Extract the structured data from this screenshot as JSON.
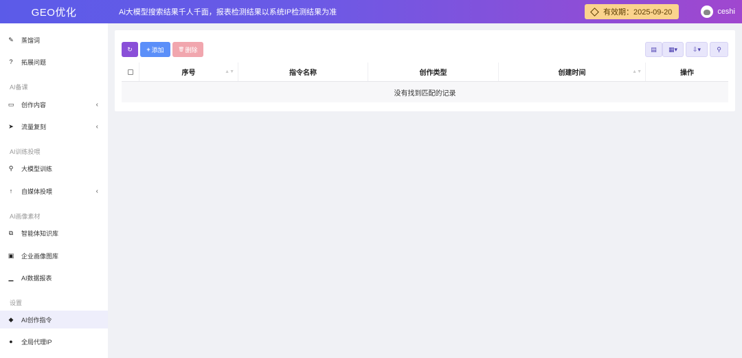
{
  "header": {
    "brand": "GEO优化",
    "notice": "Ai大模型搜索结果千人千面，报表检测结果以系统IP检测结果为准",
    "expiry_label": "有效期：2025-09-20",
    "username": "ceshi"
  },
  "sidebar": {
    "items": [
      {
        "icon": "✎",
        "label": "蒸馏词"
      },
      {
        "icon": "?",
        "label": "拓展问题"
      },
      {
        "group": "AI备课"
      },
      {
        "icon": "▭",
        "label": "创作内容",
        "chevron": "‹"
      },
      {
        "icon": "➤",
        "label": "流量复刻",
        "chevron": "‹"
      },
      {
        "group": "AI训练投喂"
      },
      {
        "icon": "⚲",
        "label": "大模型训练"
      },
      {
        "icon": "↑",
        "label": "自媒体投喂",
        "chevron": "‹"
      },
      {
        "group": "AI画像素材"
      },
      {
        "icon": "⧉",
        "label": "智能体知识库"
      },
      {
        "icon": "▣",
        "label": "企业画像图库"
      },
      {
        "icon": "▁",
        "label": "AI数据报表"
      },
      {
        "group": "设置"
      },
      {
        "icon": "◆",
        "label": "AI创作指令"
      },
      {
        "icon": "●",
        "label": "全局代理IP"
      }
    ]
  },
  "toolbar": {
    "refresh_icon": "↻",
    "add_label": "添加",
    "add_icon": "+",
    "delete_label": "删除",
    "delete_icon": "🗑"
  },
  "table": {
    "columns": [
      "序号",
      "指令名称",
      "创作类型",
      "创建时间",
      "操作"
    ],
    "empty_text": "没有找到匹配的记录"
  },
  "colors": {
    "accent": "#8a4fd8",
    "add": "#5b8ff9",
    "delete": "#f1a6ae",
    "expiry_bg": "#fbd38d"
  }
}
